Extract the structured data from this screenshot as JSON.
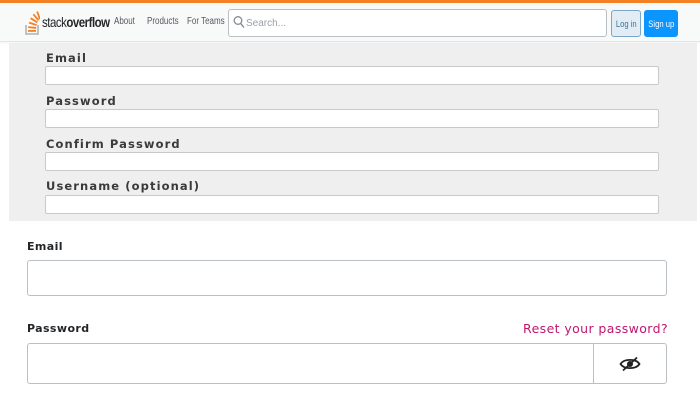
{
  "header": {
    "logo_text_light": "stack",
    "logo_text_bold": "overflow",
    "nav": [
      "About",
      "Products",
      "For Teams"
    ],
    "search_placeholder": "Search...",
    "login_label": "Log in",
    "signup_label": "Sign up",
    "accent_color": "#f48024",
    "primary_color": "#0a95ff"
  },
  "signup_panel": {
    "fields": [
      {
        "label": "Email",
        "value": ""
      },
      {
        "label": "Password",
        "value": ""
      },
      {
        "label": "Confirm Password",
        "value": ""
      },
      {
        "label": "Username (optional)",
        "value": ""
      }
    ]
  },
  "login_form": {
    "email_label": "Email",
    "email_value": "",
    "password_label": "Password",
    "password_value": "",
    "reset_link": "Reset your password?",
    "reset_link_color": "#c0166f",
    "password_toggle_icon": "eye-slash-icon"
  }
}
